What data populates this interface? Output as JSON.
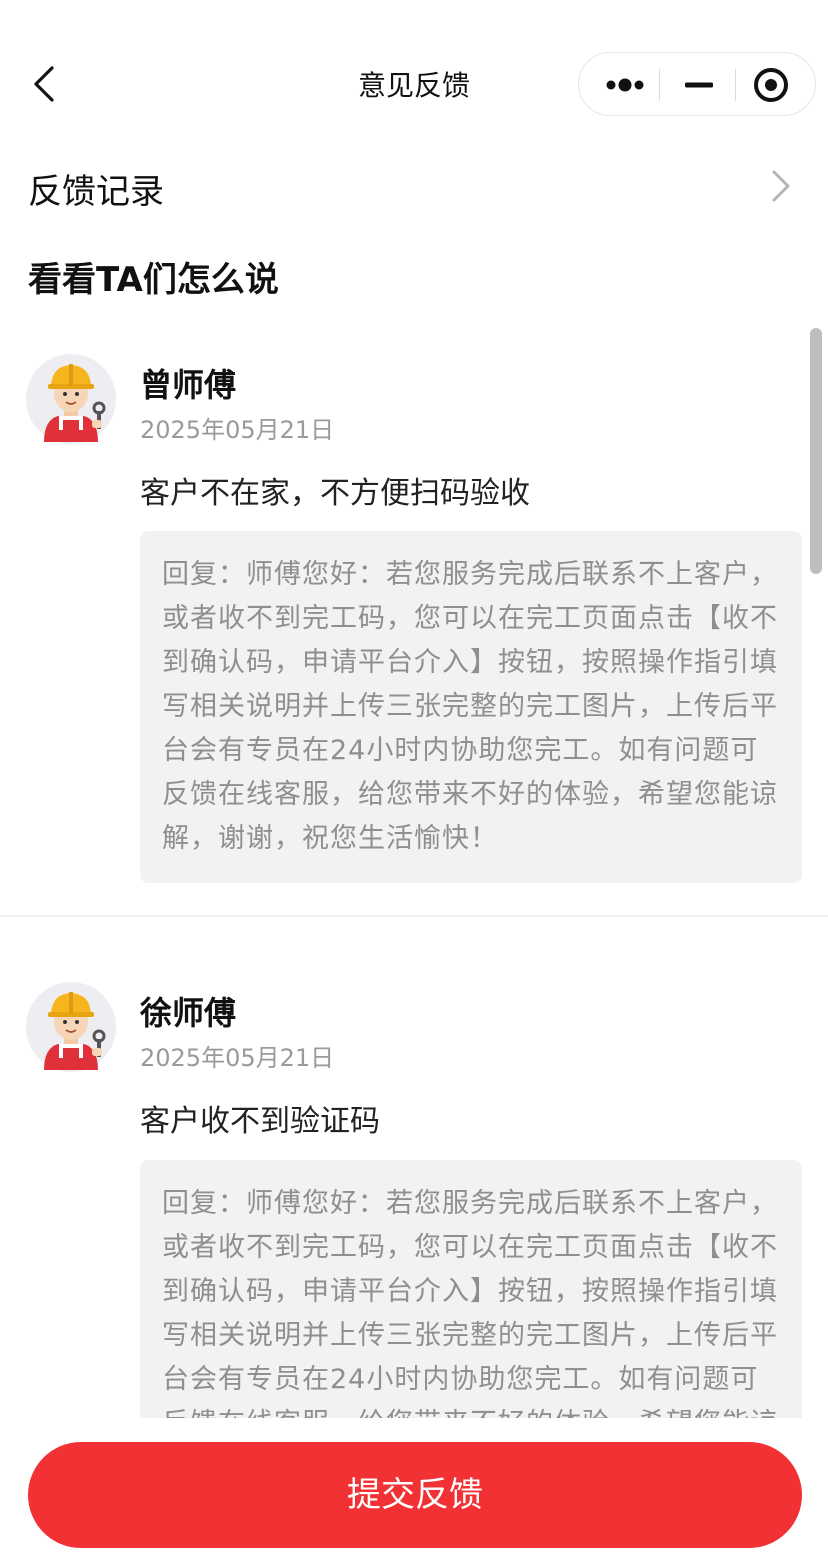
{
  "navbar": {
    "title": "意见反馈",
    "back_icon": "chevron-left-icon",
    "capsule": [
      "more-dots-icon",
      "minimize-icon",
      "target-close-icon"
    ]
  },
  "record": {
    "label": "反馈记录",
    "icon": "chevron-right-icon"
  },
  "section": {
    "title": "看看TA们怎么说"
  },
  "feedback": [
    {
      "author": "曾师傅",
      "date": "2025年05月21日",
      "content": "客户不在家，不方便扫码验收",
      "reply": "回复：师傅您好：若您服务完成后联系不上客户，或者收不到完工码，您可以在完工页面点击【收不到确认码，申请平台介入】按钮，按照操作指引填写相关说明并上传三张完整的完工图片，上传后平台会有专员在24小时内协助您完工。如有问题可反馈在线客服，给您带来不好的体验，希望您能谅解，谢谢，祝您生活愉快！"
    },
    {
      "author": "徐师傅",
      "date": "2025年05月21日",
      "content": "客户收不到验证码",
      "reply": "回复：师傅您好：若您服务完成后联系不上客户，或者收不到完工码，您可以在完工页面点击【收不到确认码，申请平台介入】按钮，按照操作指引填写相关说明并上传三张完整的完工图片，上传后平台会有专员在24小时内协助您完工。如有问题可反馈在线客服，给您带来不好的体验，希望您能谅解，谢谢，祝您生活愉快！"
    }
  ],
  "submit": {
    "label": "提交反馈"
  },
  "colors": {
    "accent": "#f23134",
    "reply_bg": "#f2f2f5",
    "muted": "#9a9a9a"
  }
}
